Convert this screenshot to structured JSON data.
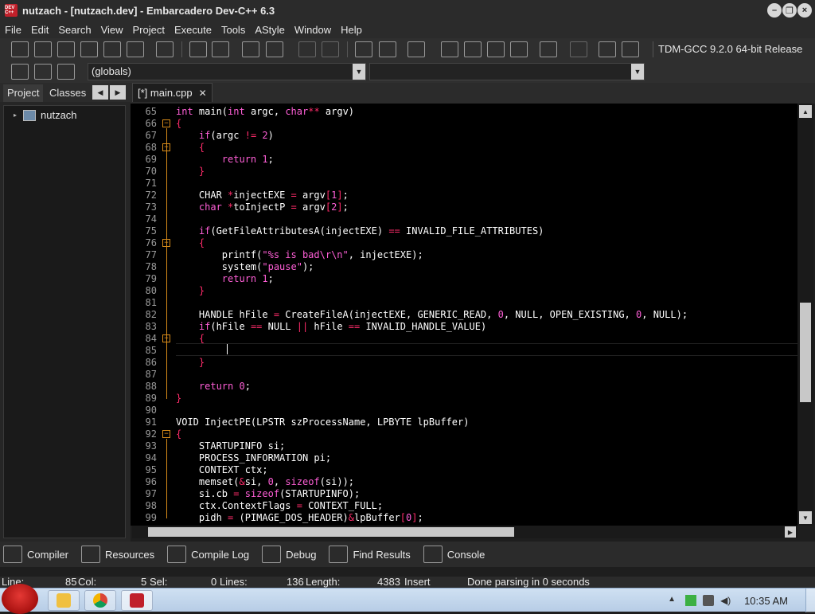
{
  "window": {
    "title": "nutzach - [nutzach.dev] - Embarcadero Dev-C++ 6.3",
    "app_icon_text": "DEV C++",
    "minimize": "–",
    "restore": "❐",
    "close": "×"
  },
  "menu": [
    "File",
    "Edit",
    "Search",
    "View",
    "Project",
    "Execute",
    "Tools",
    "AStyle",
    "Window",
    "Help"
  ],
  "toolbar": {
    "compiler": "TDM-GCC 9.2.0 64-bit Release",
    "scope_combo": "(globals)",
    "class_combo": ""
  },
  "left_panel": {
    "tabs": [
      "Project",
      "Classes"
    ],
    "active_tab": "Project",
    "tree_root": "nutzach"
  },
  "editor": {
    "tab_label": "[*] main.cpp",
    "current_line": 85,
    "lines": [
      {
        "n": "65",
        "fold": "",
        "t": "<span class='ty'>int</span> main(<span class='ty'>int</span> argc, <span class='ty'>char</span><span class='op'>**</span> argv)"
      },
      {
        "n": "66",
        "fold": "open",
        "t": "<span class='br'>{</span>"
      },
      {
        "n": "67",
        "fold": "",
        "t": "    <span class='kw'>if</span>(argc <span class='op'>!=</span> <span class='num'>2</span>)"
      },
      {
        "n": "68",
        "fold": "open",
        "t": "    <span class='br'>{</span>"
      },
      {
        "n": "69",
        "fold": "",
        "t": "        <span class='kw'>return</span> <span class='num'>1</span>;"
      },
      {
        "n": "70",
        "fold": "",
        "t": "    <span class='br'>}</span>"
      },
      {
        "n": "71",
        "fold": "",
        "t": ""
      },
      {
        "n": "72",
        "fold": "",
        "t": "    CHAR <span class='op'>*</span>injectEXE <span class='op'>=</span> argv<span class='br'>[</span><span class='num'>1</span><span class='br'>]</span>;"
      },
      {
        "n": "73",
        "fold": "",
        "t": "    <span class='ty'>char</span> <span class='op'>*</span>toInjectP <span class='op'>=</span> argv<span class='br'>[</span><span class='num'>2</span><span class='br'>]</span>;"
      },
      {
        "n": "74",
        "fold": "",
        "t": ""
      },
      {
        "n": "75",
        "fold": "",
        "t": "    <span class='kw'>if</span>(GetFileAttributesA(injectEXE) <span class='op'>==</span> INVALID_FILE_ATTRIBUTES)"
      },
      {
        "n": "76",
        "fold": "open",
        "t": "    <span class='br'>{</span>"
      },
      {
        "n": "77",
        "fold": "",
        "t": "        printf(<span class='str'>\"%s is bad\\r\\n\"</span>, injectEXE);"
      },
      {
        "n": "78",
        "fold": "",
        "t": "        system(<span class='str'>\"pause\"</span>);"
      },
      {
        "n": "79",
        "fold": "",
        "t": "        <span class='kw'>return</span> <span class='num'>1</span>;"
      },
      {
        "n": "80",
        "fold": "",
        "t": "    <span class='br'>}</span>"
      },
      {
        "n": "81",
        "fold": "",
        "t": ""
      },
      {
        "n": "82",
        "fold": "",
        "t": "    HANDLE hFile <span class='op'>=</span> CreateFileA(injectEXE, GENERIC_READ, <span class='num'>0</span>, NULL, OPEN_EXISTING, <span class='num'>0</span>, NULL);"
      },
      {
        "n": "83",
        "fold": "",
        "t": "    <span class='kw'>if</span>(hFile <span class='op'>==</span> NULL <span class='op'>||</span> hFile <span class='op'>==</span> INVALID_HANDLE_VALUE)"
      },
      {
        "n": "84",
        "fold": "open",
        "t": "    <span class='br'>{</span>"
      },
      {
        "n": "85",
        "fold": "",
        "t": ""
      },
      {
        "n": "86",
        "fold": "",
        "t": "    <span class='br'>}</span>"
      },
      {
        "n": "87",
        "fold": "",
        "t": ""
      },
      {
        "n": "88",
        "fold": "",
        "t": "    <span class='kw'>return</span> <span class='num'>0</span>;"
      },
      {
        "n": "89",
        "fold": "",
        "t": "<span class='br'>}</span>"
      },
      {
        "n": "90",
        "fold": "",
        "t": ""
      },
      {
        "n": "91",
        "fold": "",
        "t": "VOID InjectPE(LPSTR szProcessName, LPBYTE lpBuffer)"
      },
      {
        "n": "92",
        "fold": "open",
        "t": "<span class='br'>{</span>"
      },
      {
        "n": "93",
        "fold": "",
        "t": "    STARTUPINFO si;"
      },
      {
        "n": "94",
        "fold": "",
        "t": "    PROCESS_INFORMATION pi;"
      },
      {
        "n": "95",
        "fold": "",
        "t": "    CONTEXT ctx;"
      },
      {
        "n": "96",
        "fold": "",
        "t": "    memset(<span class='op'>&amp;</span>si, <span class='num'>0</span>, <span class='kw'>sizeof</span>(si));"
      },
      {
        "n": "97",
        "fold": "",
        "t": "    si.cb <span class='op'>=</span> <span class='kw'>sizeof</span>(STARTUPINFO);"
      },
      {
        "n": "98",
        "fold": "",
        "t": "    ctx.ContextFlags <span class='op'>=</span> CONTEXT_FULL;"
      },
      {
        "n": "99",
        "fold": "",
        "t": "    pidh <span class='op'>=</span> (PIMAGE_DOS_HEADER)<span class='op'>&amp;</span>lpBuffer<span class='br'>[</span><span class='num'>0</span><span class='br'>]</span>;"
      }
    ]
  },
  "bottom_tabs": [
    "Compiler",
    "Resources",
    "Compile Log",
    "Debug",
    "Find Results",
    "Console"
  ],
  "status": {
    "line_label": "Line:",
    "line_value": "85",
    "col_label": "Col:",
    "col_value": "5",
    "sel_label": "Sel:",
    "sel_value": "0",
    "lines_label": "Lines:",
    "lines_value": "136",
    "length_label": "Length:",
    "length_value": "4383",
    "mode": "Insert",
    "message": "Done parsing in 0 seconds"
  },
  "taskbar": {
    "clock": "10:35 AM",
    "apps": [
      "file-explorer",
      "chrome",
      "dev-cpp"
    ]
  },
  "colors": {
    "keyword": "#ff5fd7",
    "operator": "#ff2b6a",
    "fold_marker": "#d98c1a",
    "editor_bg": "#000000"
  }
}
